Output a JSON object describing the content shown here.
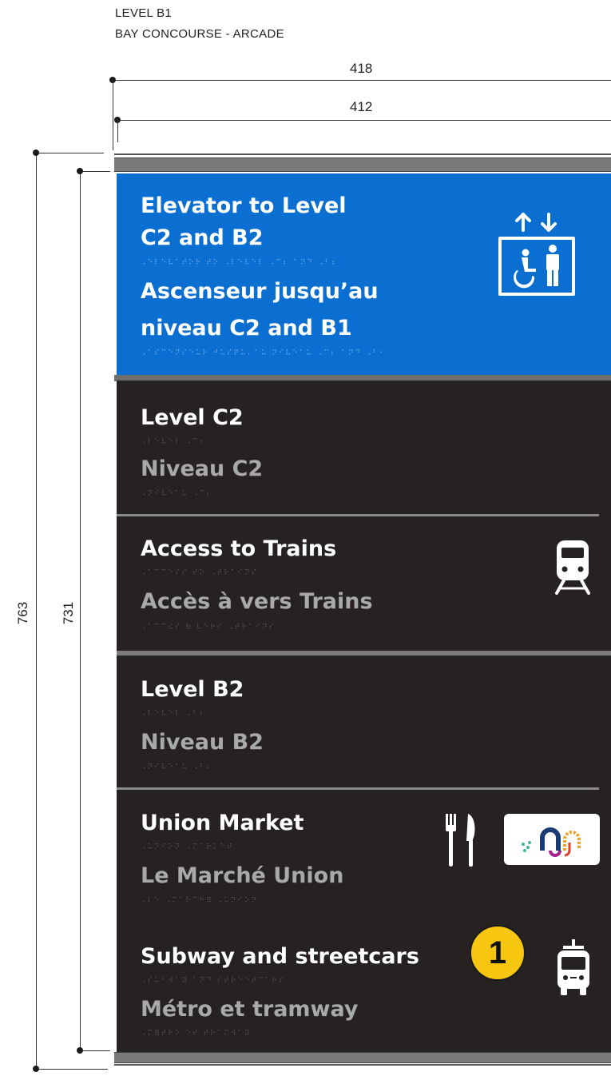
{
  "header": {
    "level": "LEVEL B1",
    "location": "BAY CONCOURSE - ARCADE"
  },
  "dimensions": {
    "outer_width": "418",
    "inner_width": "412",
    "outer_height": "763",
    "inner_height": "731"
  },
  "elevator_panel": {
    "title_en_line1": "Elevator to Level",
    "title_en_line2": "C2 and B2",
    "braille_en": "⠠⠑⠇⠑⠧⠁⠞⠕⠗ ⠞⠕ ⠠⠇⠑⠧⠑⠇ ⠠⠉⠆ ⠁⠝⠙ ⠠⠃⠆",
    "title_fr_line1": "Ascenseur jusqu’au",
    "title_fr_line2": "niveau C2 and B1",
    "braille_fr": "⠠⠁⠎⠉⠑⠝⠎⠑⠥⠗ ⠚⠥⠎⠟⠥⠄⠁⠥ ⠝⠊⠧⠑⠁⠥ ⠠⠉⠆ ⠁⠝⠙ ⠠⠃⠂",
    "icon": "elevator-accessible-icon",
    "color": "#0a6fd1"
  },
  "rows": [
    {
      "en": "Level C2",
      "braille_en": "⠠⠇⠑⠧⠑⠇ ⠠⠉⠆",
      "fr": "Niveau C2",
      "braille_fr": "⠠⠝⠊⠧⠑⠁⠥ ⠠⠉⠆"
    },
    {
      "en": "Access to Trains",
      "braille_en": "⠠⠁⠉⠉⠑⠎⠎ ⠞⠕ ⠠⠞⠗⠁⠊⠝⠎",
      "fr": "Accès à vers Trains",
      "braille_fr": "⠠⠁⠉⠉⠮⠎ ⠷ ⠧⠑⠗⠎ ⠠⠞⠗⠁⠊⠝⠎",
      "icon": "train-icon"
    },
    {
      "en": "Level B2",
      "braille_en": "⠠⠇⠑⠧⠑⠇ ⠠⠃⠆",
      "fr": "Niveau B2",
      "braille_fr": "⠠⠝⠊⠧⠑⠁⠥ ⠠⠃⠆"
    },
    {
      "en": "Union Market",
      "braille_en": "⠠⠥⠝⠊⠕⠝ ⠠⠍⠁⠗⠅⠑⠞",
      "fr": "Le Marché Union",
      "braille_fr": "⠠⠇⠑ ⠠⠍⠁⠗⠉⠓⠿ ⠠⠥⠝⠊⠕⠝",
      "icon": "fork-knife-icon",
      "logo": "union-market-logo"
    },
    {
      "en": "Subway and streetcars",
      "braille_en": "⠠⠎⠥⠃⠺⠁⠽ ⠁⠝⠙ ⠎⠞⠗⠑⠑⠞⠉⠁⠗⠎",
      "fr": "Métro et tramway",
      "braille_fr": "⠠⠍⠿⠞⠗⠕ ⠑⠞ ⠞⠗⠁⠍⠺⠁⠽",
      "badge": "1",
      "badge_color": "#f6c611",
      "icon": "streetcar-icon"
    }
  ],
  "colors": {
    "sign_dark": "#262222",
    "text_secondary": "#a9a9a9"
  }
}
